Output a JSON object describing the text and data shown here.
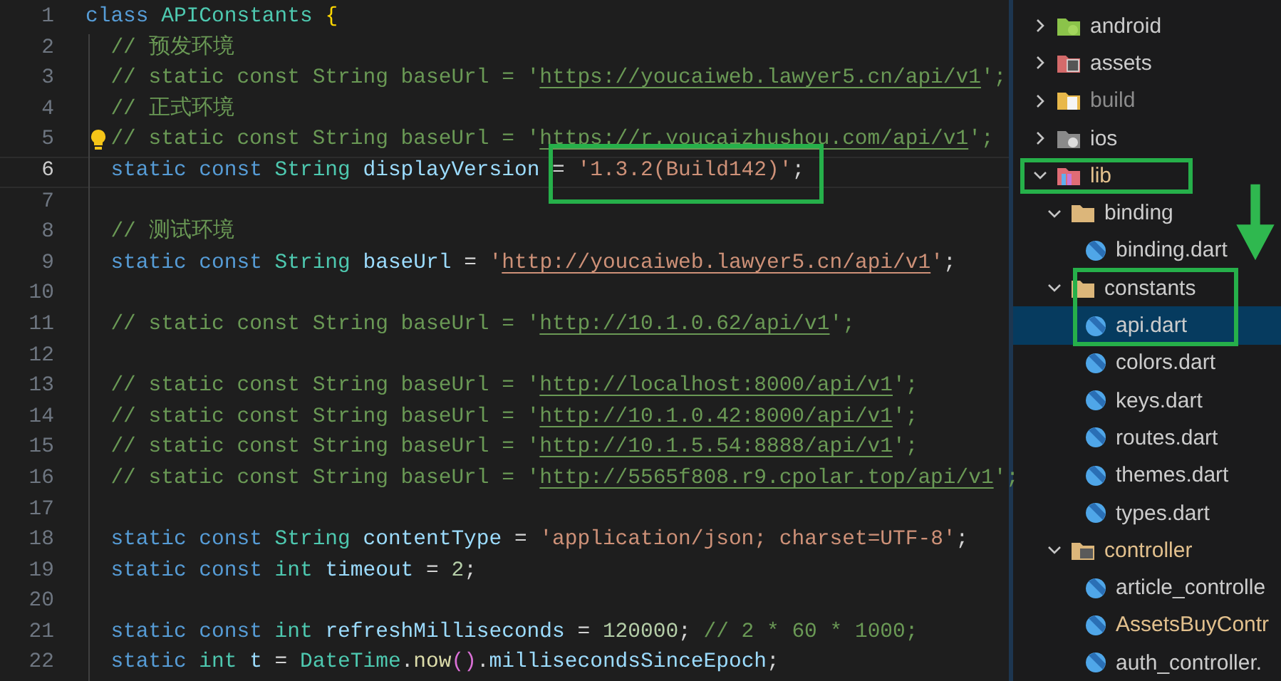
{
  "editor": {
    "lines": [
      {
        "number": "1",
        "current": false,
        "lightbulb": false,
        "tokens": [
          {
            "kind": "keyword",
            "text": "class "
          },
          {
            "kind": "type",
            "text": "APIConstants "
          },
          {
            "kind": "brace",
            "text": "{"
          }
        ]
      },
      {
        "number": "2",
        "current": false,
        "lightbulb": false,
        "tokens": [
          {
            "kind": "comment",
            "text": "  // 预发环境"
          }
        ]
      },
      {
        "number": "3",
        "current": false,
        "lightbulb": false,
        "tokens": [
          {
            "kind": "comment",
            "text": "  // static const String baseUrl = '"
          },
          {
            "kind": "comment-link",
            "text": "https://youcaiweb.lawyer5.cn/api/v1"
          },
          {
            "kind": "comment",
            "text": "';"
          }
        ]
      },
      {
        "number": "4",
        "current": false,
        "lightbulb": false,
        "tokens": [
          {
            "kind": "comment",
            "text": "  // 正式环境"
          }
        ]
      },
      {
        "number": "5",
        "current": false,
        "lightbulb": true,
        "tokens": [
          {
            "kind": "comment",
            "text": "// static const String baseUrl = '"
          },
          {
            "kind": "comment-link",
            "text": "https://r.youcaizhushou.com/api/v1"
          },
          {
            "kind": "comment",
            "text": "';"
          }
        ]
      },
      {
        "number": "6",
        "current": true,
        "lightbulb": false,
        "tokens": [
          {
            "kind": "keyword",
            "text": "  static const "
          },
          {
            "kind": "type",
            "text": "String "
          },
          {
            "kind": "variable",
            "text": "displayVersion"
          },
          {
            "kind": "plain",
            "text": " = "
          },
          {
            "kind": "string",
            "text": "'1.3.2(Build142)'"
          },
          {
            "kind": "plain",
            "text": ";"
          }
        ]
      },
      {
        "number": "7",
        "current": false
      },
      {
        "number": "8",
        "current": false,
        "lightbulb": false,
        "tokens": [
          {
            "kind": "comment",
            "text": "  // 测试环境"
          }
        ]
      },
      {
        "number": "9",
        "current": false,
        "lightbulb": false,
        "tokens": [
          {
            "kind": "keyword",
            "text": "  static const "
          },
          {
            "kind": "type",
            "text": "String "
          },
          {
            "kind": "variable",
            "text": "baseUrl"
          },
          {
            "kind": "plain",
            "text": " = "
          },
          {
            "kind": "string",
            "text": "'"
          },
          {
            "kind": "link",
            "text": "http://youcaiweb.lawyer5.cn/api/v1"
          },
          {
            "kind": "string",
            "text": "'"
          },
          {
            "kind": "plain",
            "text": ";"
          }
        ]
      },
      {
        "number": "10",
        "current": false
      },
      {
        "number": "11",
        "current": false,
        "lightbulb": false,
        "tokens": [
          {
            "kind": "comment",
            "text": "  // static const String baseUrl = '"
          },
          {
            "kind": "comment-link",
            "text": "http://10.1.0.62/api/v1"
          },
          {
            "kind": "comment",
            "text": "';"
          }
        ]
      },
      {
        "number": "12",
        "current": false
      },
      {
        "number": "13",
        "current": false,
        "lightbulb": false,
        "tokens": [
          {
            "kind": "comment",
            "text": "  // static const String baseUrl = '"
          },
          {
            "kind": "comment-link",
            "text": "http://localhost:8000/api/v1"
          },
          {
            "kind": "comment",
            "text": "';"
          }
        ]
      },
      {
        "number": "14",
        "current": false,
        "lightbulb": false,
        "tokens": [
          {
            "kind": "comment",
            "text": "  // static const String baseUrl = '"
          },
          {
            "kind": "comment-link",
            "text": "http://10.1.0.42:8000/api/v1"
          },
          {
            "kind": "comment",
            "text": "';"
          }
        ]
      },
      {
        "number": "15",
        "current": false,
        "lightbulb": false,
        "tokens": [
          {
            "kind": "comment",
            "text": "  // static const String baseUrl = '"
          },
          {
            "kind": "comment-link",
            "text": "http://10.1.5.54:8888/api/v1"
          },
          {
            "kind": "comment",
            "text": "';"
          }
        ]
      },
      {
        "number": "16",
        "current": false,
        "lightbulb": false,
        "tokens": [
          {
            "kind": "comment",
            "text": "  // static const String baseUrl = '"
          },
          {
            "kind": "comment-link",
            "text": "http://5565f808.r9.cpolar.top/api/v1"
          },
          {
            "kind": "comment",
            "text": "';"
          }
        ]
      },
      {
        "number": "17",
        "current": false
      },
      {
        "number": "18",
        "current": false,
        "lightbulb": false,
        "tokens": [
          {
            "kind": "keyword",
            "text": "  static const "
          },
          {
            "kind": "type",
            "text": "String "
          },
          {
            "kind": "variable",
            "text": "contentType"
          },
          {
            "kind": "plain",
            "text": " = "
          },
          {
            "kind": "string",
            "text": "'application/json; charset=UTF-8'"
          },
          {
            "kind": "plain",
            "text": ";"
          }
        ]
      },
      {
        "number": "19",
        "current": false,
        "lightbulb": false,
        "tokens": [
          {
            "kind": "keyword",
            "text": "  static const "
          },
          {
            "kind": "type",
            "text": "int "
          },
          {
            "kind": "variable",
            "text": "timeout"
          },
          {
            "kind": "plain",
            "text": " = "
          },
          {
            "kind": "number",
            "text": "2"
          },
          {
            "kind": "plain",
            "text": ";"
          }
        ]
      },
      {
        "number": "20",
        "current": false
      },
      {
        "number": "21",
        "current": false,
        "lightbulb": false,
        "tokens": [
          {
            "kind": "keyword",
            "text": "  static const "
          },
          {
            "kind": "type",
            "text": "int "
          },
          {
            "kind": "variable",
            "text": "refreshMilliseconds"
          },
          {
            "kind": "plain",
            "text": " = "
          },
          {
            "kind": "number",
            "text": "120000"
          },
          {
            "kind": "plain",
            "text": "; "
          },
          {
            "kind": "comment",
            "text": "// 2 * 60 * 1000;"
          }
        ]
      },
      {
        "number": "22",
        "current": false,
        "lightbulb": false,
        "tokens": [
          {
            "kind": "keyword",
            "text": "  static "
          },
          {
            "kind": "type",
            "text": "int "
          },
          {
            "kind": "variable",
            "text": "t"
          },
          {
            "kind": "plain",
            "text": " = "
          },
          {
            "kind": "type",
            "text": "DateTime"
          },
          {
            "kind": "plain",
            "text": "."
          },
          {
            "kind": "function",
            "text": "now"
          },
          {
            "kind": "paren",
            "text": "()"
          },
          {
            "kind": "plain",
            "text": "."
          },
          {
            "kind": "variable",
            "text": "millisecondsSinceEpoch"
          },
          {
            "kind": "plain",
            "text": ";"
          }
        ]
      }
    ]
  },
  "explorer": {
    "items": [
      {
        "name": "android",
        "kind": "android",
        "expanded": false,
        "selected": false,
        "modified": false,
        "ignored": false
      },
      {
        "name": "assets",
        "kind": "assets",
        "expanded": false,
        "selected": false,
        "modified": false,
        "ignored": false
      },
      {
        "name": "build",
        "kind": "build",
        "expanded": false,
        "selected": false,
        "modified": false,
        "ignored": true
      },
      {
        "name": "ios",
        "kind": "ios",
        "expanded": false,
        "selected": false,
        "modified": false,
        "ignored": false
      },
      {
        "name": "lib",
        "kind": "lib",
        "expanded": true,
        "selected": false,
        "modified": true,
        "ignored": false,
        "children": [
          {
            "name": "binding",
            "kind": "folder",
            "expanded": true,
            "selected": false,
            "modified": false,
            "ignored": false,
            "children": [
              {
                "name": "binding.dart",
                "kind": "dart",
                "selected": false,
                "modified": false,
                "ignored": false
              }
            ]
          },
          {
            "name": "constants",
            "kind": "folder",
            "expanded": true,
            "selected": false,
            "modified": false,
            "ignored": false,
            "children": [
              {
                "name": "api.dart",
                "kind": "dart",
                "selected": true,
                "modified": false,
                "ignored": false
              },
              {
                "name": "colors.dart",
                "kind": "dart",
                "selected": false,
                "modified": false,
                "ignored": false
              },
              {
                "name": "keys.dart",
                "kind": "dart",
                "selected": false,
                "modified": false,
                "ignored": false
              },
              {
                "name": "routes.dart",
                "kind": "dart",
                "selected": false,
                "modified": false,
                "ignored": false
              },
              {
                "name": "themes.dart",
                "kind": "dart",
                "selected": false,
                "modified": false,
                "ignored": false
              },
              {
                "name": "types.dart",
                "kind": "dart",
                "selected": false,
                "modified": false,
                "ignored": false
              }
            ]
          },
          {
            "name": "controller",
            "kind": "controller",
            "expanded": true,
            "selected": false,
            "modified": true,
            "ignored": false,
            "children": [
              {
                "name": "article_controlle",
                "kind": "dart",
                "selected": false,
                "modified": false,
                "ignored": false
              },
              {
                "name": "AssetsBuyContr",
                "kind": "dart",
                "selected": false,
                "modified": true,
                "ignored": false
              },
              {
                "name": "auth_controller.",
                "kind": "dart",
                "selected": false,
                "modified": false,
                "ignored": false
              }
            ]
          }
        ]
      }
    ]
  }
}
